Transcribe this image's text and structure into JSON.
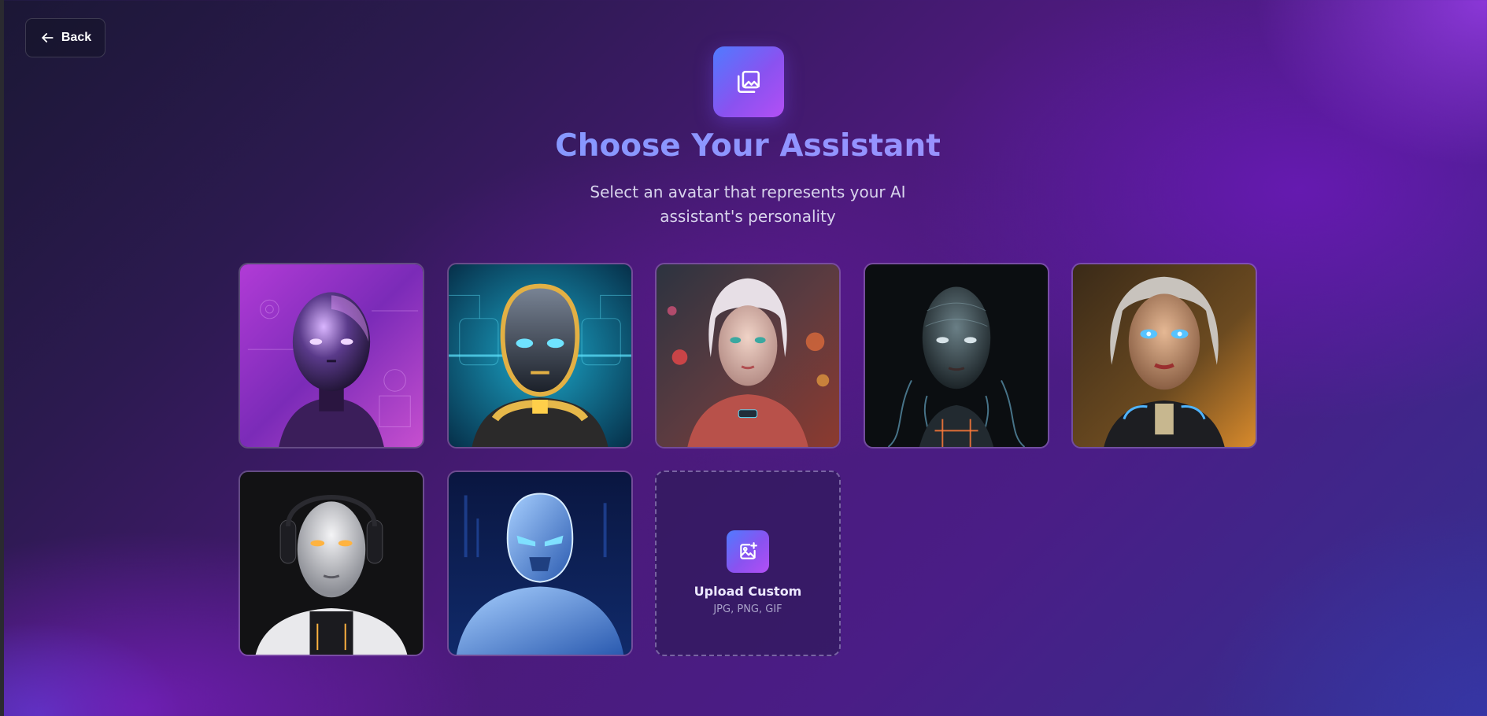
{
  "nav": {
    "back_label": "Back",
    "back_icon": "arrow-left-icon"
  },
  "header": {
    "icon": "image-stack-icon",
    "title": "Choose Your Assistant",
    "subtitle": "Select an avatar that represents your AI assistant's personality"
  },
  "avatars": [
    {
      "name": "avatar-1",
      "description": "purple chrome humanoid robot on circuit background"
    },
    {
      "name": "avatar-2",
      "description": "gold and black robot with glowing blue eyes on cyan circuit background"
    },
    {
      "name": "avatar-3",
      "description": "cyborg woman with silver hair and neon city lights"
    },
    {
      "name": "avatar-4",
      "description": "dark cyborg woman with cables and glowing orange lines"
    },
    {
      "name": "avatar-5",
      "description": "android woman with glowing blue eyes and warm lighting"
    },
    {
      "name": "avatar-6",
      "description": "white and black android woman with amber eyes and headphones"
    },
    {
      "name": "avatar-7",
      "description": "blue armored robot with glowing visor"
    }
  ],
  "upload": {
    "icon": "image-plus-icon",
    "label": "Upload Custom",
    "hint": "JPG, PNG, GIF"
  },
  "colors": {
    "accent_start": "#4f7bff",
    "accent_end": "#b34ff5"
  }
}
